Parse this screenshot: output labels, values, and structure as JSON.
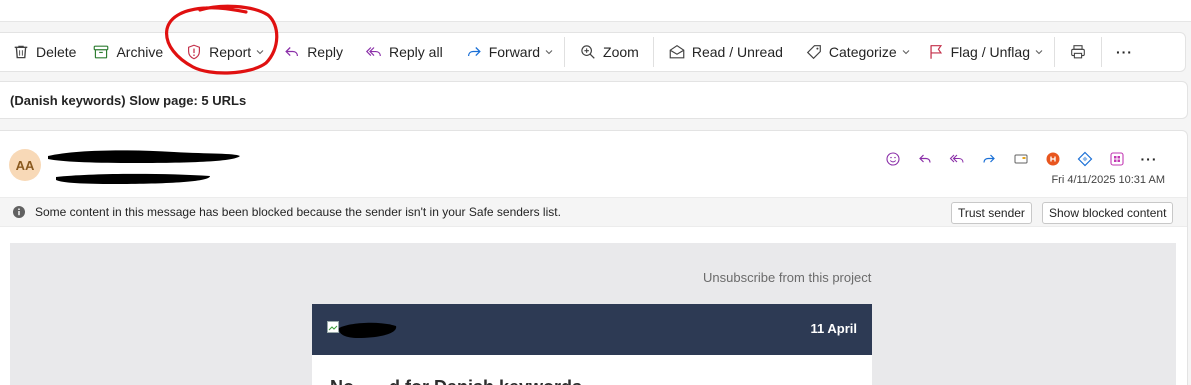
{
  "toolbar": {
    "delete": "Delete",
    "archive": "Archive",
    "report": "Report",
    "reply": "Reply",
    "reply_all": "Reply all",
    "forward": "Forward",
    "zoom": "Zoom",
    "read_unread": "Read / Unread",
    "categorize": "Categorize",
    "flag": "Flag / Unflag",
    "more": "···"
  },
  "subject": "(Danish keywords) Slow page: 5 URLs",
  "message": {
    "avatar_initials": "AA",
    "date": "Fri 4/11/2025 10:31 AM",
    "more": "···",
    "blocked_notice": "Some content in this message has been blocked because the sender isn't in your Safe senders list.",
    "trust_sender": "Trust sender",
    "show_blocked": "Show blocked content"
  },
  "email": {
    "unsubscribe": "Unsubscribe from this project",
    "banner_date": "11 April",
    "heading": "No.......d for Danish keywords"
  },
  "colors": {
    "accent_purple": "#8a2ea8",
    "accent_blue": "#1a6fd6",
    "flag_red": "#c4314b",
    "archive_green": "#2f7d32",
    "banner_navy": "#2d3a54",
    "annotation_red": "#e01010"
  }
}
